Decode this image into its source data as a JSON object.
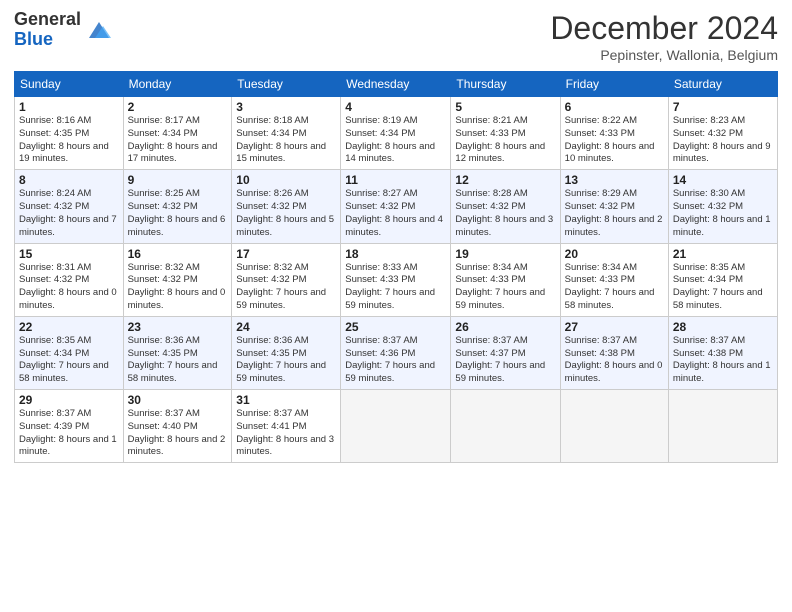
{
  "logo": {
    "general": "General",
    "blue": "Blue"
  },
  "title": "December 2024",
  "subtitle": "Pepinster, Wallonia, Belgium",
  "weekdays": [
    "Sunday",
    "Monday",
    "Tuesday",
    "Wednesday",
    "Thursday",
    "Friday",
    "Saturday"
  ],
  "weeks": [
    [
      {
        "day": 1,
        "sunrise": "8:16 AM",
        "sunset": "4:35 PM",
        "daylight": "8 hours and 19 minutes."
      },
      {
        "day": 2,
        "sunrise": "8:17 AM",
        "sunset": "4:34 PM",
        "daylight": "8 hours and 17 minutes."
      },
      {
        "day": 3,
        "sunrise": "8:18 AM",
        "sunset": "4:34 PM",
        "daylight": "8 hours and 15 minutes."
      },
      {
        "day": 4,
        "sunrise": "8:19 AM",
        "sunset": "4:34 PM",
        "daylight": "8 hours and 14 minutes."
      },
      {
        "day": 5,
        "sunrise": "8:21 AM",
        "sunset": "4:33 PM",
        "daylight": "8 hours and 12 minutes."
      },
      {
        "day": 6,
        "sunrise": "8:22 AM",
        "sunset": "4:33 PM",
        "daylight": "8 hours and 10 minutes."
      },
      {
        "day": 7,
        "sunrise": "8:23 AM",
        "sunset": "4:32 PM",
        "daylight": "8 hours and 9 minutes."
      }
    ],
    [
      {
        "day": 8,
        "sunrise": "8:24 AM",
        "sunset": "4:32 PM",
        "daylight": "8 hours and 7 minutes."
      },
      {
        "day": 9,
        "sunrise": "8:25 AM",
        "sunset": "4:32 PM",
        "daylight": "8 hours and 6 minutes."
      },
      {
        "day": 10,
        "sunrise": "8:26 AM",
        "sunset": "4:32 PM",
        "daylight": "8 hours and 5 minutes."
      },
      {
        "day": 11,
        "sunrise": "8:27 AM",
        "sunset": "4:32 PM",
        "daylight": "8 hours and 4 minutes."
      },
      {
        "day": 12,
        "sunrise": "8:28 AM",
        "sunset": "4:32 PM",
        "daylight": "8 hours and 3 minutes."
      },
      {
        "day": 13,
        "sunrise": "8:29 AM",
        "sunset": "4:32 PM",
        "daylight": "8 hours and 2 minutes."
      },
      {
        "day": 14,
        "sunrise": "8:30 AM",
        "sunset": "4:32 PM",
        "daylight": "8 hours and 1 minute."
      }
    ],
    [
      {
        "day": 15,
        "sunrise": "8:31 AM",
        "sunset": "4:32 PM",
        "daylight": "8 hours and 0 minutes."
      },
      {
        "day": 16,
        "sunrise": "8:32 AM",
        "sunset": "4:32 PM",
        "daylight": "8 hours and 0 minutes."
      },
      {
        "day": 17,
        "sunrise": "8:32 AM",
        "sunset": "4:32 PM",
        "daylight": "7 hours and 59 minutes."
      },
      {
        "day": 18,
        "sunrise": "8:33 AM",
        "sunset": "4:33 PM",
        "daylight": "7 hours and 59 minutes."
      },
      {
        "day": 19,
        "sunrise": "8:34 AM",
        "sunset": "4:33 PM",
        "daylight": "7 hours and 59 minutes."
      },
      {
        "day": 20,
        "sunrise": "8:34 AM",
        "sunset": "4:33 PM",
        "daylight": "7 hours and 58 minutes."
      },
      {
        "day": 21,
        "sunrise": "8:35 AM",
        "sunset": "4:34 PM",
        "daylight": "7 hours and 58 minutes."
      }
    ],
    [
      {
        "day": 22,
        "sunrise": "8:35 AM",
        "sunset": "4:34 PM",
        "daylight": "7 hours and 58 minutes."
      },
      {
        "day": 23,
        "sunrise": "8:36 AM",
        "sunset": "4:35 PM",
        "daylight": "7 hours and 58 minutes."
      },
      {
        "day": 24,
        "sunrise": "8:36 AM",
        "sunset": "4:35 PM",
        "daylight": "7 hours and 59 minutes."
      },
      {
        "day": 25,
        "sunrise": "8:37 AM",
        "sunset": "4:36 PM",
        "daylight": "7 hours and 59 minutes."
      },
      {
        "day": 26,
        "sunrise": "8:37 AM",
        "sunset": "4:37 PM",
        "daylight": "7 hours and 59 minutes."
      },
      {
        "day": 27,
        "sunrise": "8:37 AM",
        "sunset": "4:38 PM",
        "daylight": "8 hours and 0 minutes."
      },
      {
        "day": 28,
        "sunrise": "8:37 AM",
        "sunset": "4:38 PM",
        "daylight": "8 hours and 1 minute."
      }
    ],
    [
      {
        "day": 29,
        "sunrise": "8:37 AM",
        "sunset": "4:39 PM",
        "daylight": "8 hours and 1 minute."
      },
      {
        "day": 30,
        "sunrise": "8:37 AM",
        "sunset": "4:40 PM",
        "daylight": "8 hours and 2 minutes."
      },
      {
        "day": 31,
        "sunrise": "8:37 AM",
        "sunset": "4:41 PM",
        "daylight": "8 hours and 3 minutes."
      },
      null,
      null,
      null,
      null
    ]
  ],
  "labels": {
    "sunrise": "Sunrise:",
    "sunset": "Sunset:",
    "daylight": "Daylight:"
  }
}
